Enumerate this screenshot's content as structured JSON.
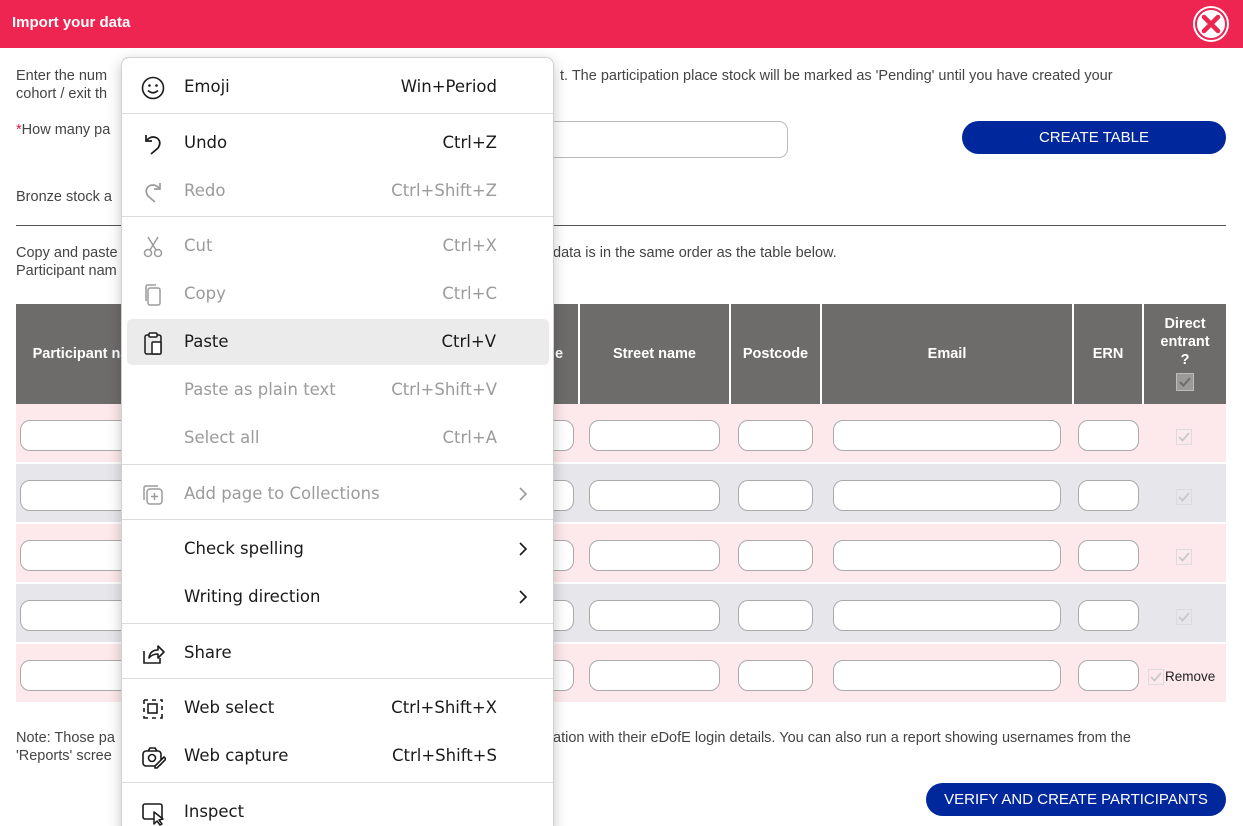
{
  "dialog": {
    "title": "Import your data",
    "close_icon": "close-icon"
  },
  "intro": {
    "line1_left": "Enter the num",
    "line1_right": "t. The participation place stock will be marked as 'Pending' until you have created your",
    "line2": "cohort / exit th"
  },
  "count_field": {
    "required_mark": "*",
    "label": "How many pa",
    "value": ""
  },
  "create_table_label": "CREATE TABLE",
  "stock_text": "Bronze stock a",
  "paste_instructions": {
    "line1_left": "Copy and paste",
    "line1_right": "data is in the same order as the table below.",
    "line2": "Participant nam"
  },
  "table": {
    "headers": {
      "participant_name": "Participant name",
      "partial": "e",
      "street_name": "Street name",
      "postcode": "Postcode",
      "email": "Email",
      "ern": "ERN",
      "direct_entrant": "Direct entrant ?"
    },
    "rows": [
      {
        "shade": "pink",
        "direct_entrant_checked": true
      },
      {
        "shade": "grey",
        "direct_entrant_checked": true
      },
      {
        "shade": "pink",
        "direct_entrant_checked": true
      },
      {
        "shade": "grey",
        "direct_entrant_checked": true
      },
      {
        "shade": "pink",
        "direct_entrant_checked": true,
        "remove_label": "Remove"
      }
    ]
  },
  "note": {
    "line1_left": "Note: Those pa",
    "line1_right": "ation with their eDofE login details. You can also run a report showing usernames from the",
    "line2": "'Reports' scree"
  },
  "verify_label": "VERIFY AND CREATE PARTICIPANTS",
  "context_menu": {
    "items": [
      {
        "label": "Emoji",
        "shortcut": "Win+Period",
        "icon": "emoji-icon",
        "disabled": false
      },
      {
        "label": "Undo",
        "shortcut": "Ctrl+Z",
        "icon": "undo-icon",
        "disabled": false
      },
      {
        "label": "Redo",
        "shortcut": "Ctrl+Shift+Z",
        "icon": "redo-icon",
        "disabled": true
      },
      {
        "label": "Cut",
        "shortcut": "Ctrl+X",
        "icon": "cut-icon",
        "disabled": true
      },
      {
        "label": "Copy",
        "shortcut": "Ctrl+C",
        "icon": "copy-icon",
        "disabled": true
      },
      {
        "label": "Paste",
        "shortcut": "Ctrl+V",
        "icon": "paste-icon",
        "disabled": false,
        "highlighted": true
      },
      {
        "label": "Paste as plain text",
        "shortcut": "Ctrl+Shift+V",
        "disabled": true
      },
      {
        "label": "Select all",
        "shortcut": "Ctrl+A",
        "disabled": true
      },
      {
        "label": "Add page to Collections",
        "icon": "collections-icon",
        "disabled": true,
        "submenu": true
      },
      {
        "label": "Check spelling",
        "disabled": false,
        "submenu": true
      },
      {
        "label": "Writing direction",
        "disabled": false,
        "submenu": true
      },
      {
        "label": "Share",
        "icon": "share-icon",
        "disabled": false
      },
      {
        "label": "Web select",
        "shortcut": "Ctrl+Shift+X",
        "icon": "web-select-icon",
        "disabled": false
      },
      {
        "label": "Web capture",
        "shortcut": "Ctrl+Shift+S",
        "icon": "web-capture-icon",
        "disabled": false
      },
      {
        "label": "Inspect",
        "icon": "inspect-icon",
        "disabled": false
      }
    ]
  },
  "colors": {
    "header_bar": "#ee2451",
    "primary_button": "#00279c",
    "table_header": "#6e6c6b",
    "row_pink": "#fde9ec",
    "row_grey": "#e7e7eb"
  }
}
